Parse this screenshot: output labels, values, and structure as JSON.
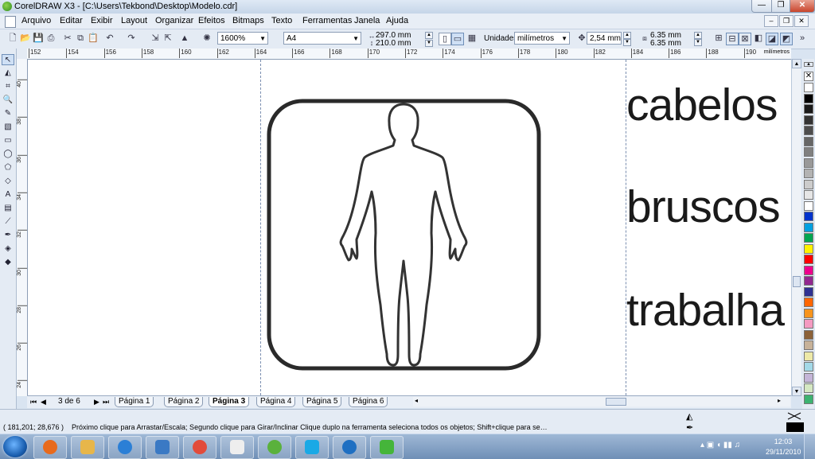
{
  "window": {
    "title": "CorelDRAW X3 - [C:\\Users\\Tekbond\\Desktop\\Modelo.cdr]",
    "min_glyph": "—",
    "max_glyph": "❐",
    "close_glyph": "✕"
  },
  "menu": [
    "Arquivo",
    "Editar",
    "Exibir",
    "Layout",
    "Organizar",
    "Efeitos",
    "Bitmaps",
    "Texto",
    "Ferramentas",
    "Janela",
    "Ajuda"
  ],
  "propbar": {
    "zoom": "1600%",
    "paper": "A4",
    "width": "297.0 mm",
    "height": "210.0 mm",
    "units_label": "Unidades:",
    "units_value": "milímetros",
    "nudge": "2,54 mm",
    "dup_x": "6.35 mm",
    "dup_y": "6.35 mm"
  },
  "ruler": {
    "units": "milímetros",
    "top_ticks": [
      "152",
      "154",
      "156",
      "158",
      "160",
      "162",
      "164",
      "166",
      "168",
      "170",
      "172",
      "174",
      "176",
      "178",
      "180",
      "182",
      "184",
      "186",
      "188",
      "190"
    ],
    "left_ticks": [
      "40",
      "38",
      "36",
      "34",
      "32",
      "30",
      "28",
      "26",
      "24"
    ]
  },
  "canvas": {
    "words": [
      "cabelos",
      "bruscos",
      "trabalha"
    ]
  },
  "pages": {
    "count_text": "3 de 6",
    "tabs": [
      "Página 1",
      "Página 2",
      "Página 3",
      "Página 4",
      "Página 5",
      "Página 6"
    ],
    "active_index": 2
  },
  "status": {
    "coords": "( 181,201; 28,676 )",
    "hint": "Próximo clique para Arrastar/Escala; Segundo clique para Girar/Inclinar Clique duplo na ferramenta seleciona todos os objetos; Shift+clique para se…"
  },
  "palette": [
    "#ffffff",
    "#000000",
    "#1a1a1a",
    "#333333",
    "#4d4d4d",
    "#666666",
    "#808080",
    "#999999",
    "#b3b3b3",
    "#cccccc",
    "#e6e6e6",
    "#ffffff",
    "#0033cc",
    "#00a0e0",
    "#00a651",
    "#fff200",
    "#ff0000",
    "#ed008c",
    "#92278f",
    "#2e3192",
    "#ff6600",
    "#f7941d",
    "#f49ac1",
    "#8c6239",
    "#c7b299",
    "#ede9a8",
    "#a3d9e8",
    "#c4b5d8",
    "#d4e8c2",
    "#3cb371"
  ],
  "taskbar": {
    "apps": [
      "media-player",
      "file-explorer",
      "internet-explorer",
      "mail-client",
      "chrome",
      "fax-viewer",
      "messenger",
      "skype",
      "flash-app",
      "coreldraw"
    ],
    "clock_time": "12:03",
    "clock_date": "29/11/2010"
  }
}
